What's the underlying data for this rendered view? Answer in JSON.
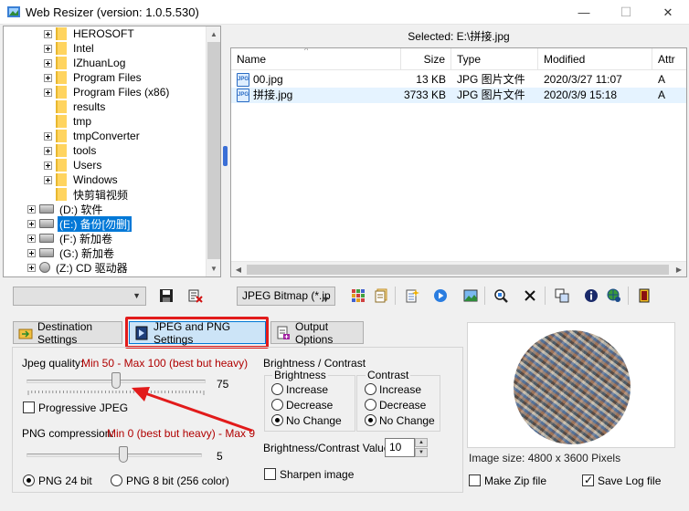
{
  "window": {
    "title": "Web Resizer (version: 1.0.5.530)",
    "minimize_glyph": "—",
    "maximize_glyph": "☐",
    "close_glyph": "✕"
  },
  "tree": {
    "items": [
      {
        "label": "HEROSOFT",
        "type": "folder",
        "expandable": true
      },
      {
        "label": "Intel",
        "type": "folder",
        "expandable": true
      },
      {
        "label": "IZhuanLog",
        "type": "folder",
        "expandable": true
      },
      {
        "label": "Program Files",
        "type": "folder",
        "expandable": true
      },
      {
        "label": "Program Files (x86)",
        "type": "folder",
        "expandable": true
      },
      {
        "label": "results",
        "type": "folder",
        "expandable": false
      },
      {
        "label": "tmp",
        "type": "folder",
        "expandable": false
      },
      {
        "label": "tmpConverter",
        "type": "folder",
        "expandable": true
      },
      {
        "label": "tools",
        "type": "folder",
        "expandable": true
      },
      {
        "label": "Users",
        "type": "folder",
        "expandable": true
      },
      {
        "label": "Windows",
        "type": "folder",
        "expandable": true
      },
      {
        "label": "快剪辑视频",
        "type": "folder",
        "expandable": false
      },
      {
        "label": "(D:) 软件",
        "type": "drive",
        "expandable": true
      },
      {
        "label": "(E:) 备份[勿删]",
        "type": "drive",
        "expandable": true,
        "selected": true
      },
      {
        "label": "(F:) 新加卷",
        "type": "drive",
        "expandable": true
      },
      {
        "label": "(G:) 新加卷",
        "type": "drive",
        "expandable": true
      },
      {
        "label": "(Z:) CD 驱动器",
        "type": "cd",
        "expandable": true
      }
    ]
  },
  "files": {
    "selected_path": "Selected: E:\\拼接.jpg",
    "columns": [
      "Name",
      "Size",
      "Type",
      "Modified",
      "Attr"
    ],
    "rows": [
      {
        "name": "00.jpg",
        "size": "13 KB",
        "type": "JPG 图片文件",
        "modified": "2020/3/27 11:07",
        "attr": "A"
      },
      {
        "name": "拼接.jpg",
        "size": "3733 KB",
        "type": "JPG 图片文件",
        "modified": "2020/3/9 15:18",
        "attr": "A"
      }
    ]
  },
  "toolbar": {
    "left_combo_value": "",
    "format_combo_value": "JPEG Bitmap (*.jp"
  },
  "tabs": {
    "destination": "Destination Settings",
    "jpeg_png": "JPEG and PNG Settings",
    "output": "Output Options"
  },
  "jpeg": {
    "quality_label": "Jpeg quality:",
    "quality_hint": "Min 50 - Max 100 (best but heavy)",
    "quality_value": "75",
    "quality_min": 50,
    "quality_max": 100,
    "progressive_label": "Progressive JPEG",
    "progressive_checked": false
  },
  "png": {
    "compression_label": "PNG compression:",
    "compression_hint": "Min 0 (best but heavy) - Max 9",
    "compression_value": "5",
    "compression_min": 0,
    "compression_max": 9,
    "bit24_label": "PNG 24 bit",
    "bit8_label": "PNG 8 bit (256 color)",
    "selected": "24"
  },
  "brightness_contrast": {
    "group_label": "Brightness / Contrast",
    "brightness_label": "Brightness",
    "contrast_label": "Contrast",
    "increase": "Increase",
    "decrease": "Decrease",
    "no_change": "No Change",
    "brightness_selected": "no_change",
    "contrast_selected": "no_change",
    "value_label": "Brightness/Contrast Value:",
    "value": "10",
    "sharpen_label": "Sharpen image",
    "sharpen_checked": false
  },
  "preview": {
    "size_text": "Image size: 4800 x 3600 Pixels",
    "make_zip_label": "Make Zip file",
    "make_zip_checked": false,
    "save_log_label": "Save Log file",
    "save_log_checked": true
  },
  "colors": {
    "selection": "#0078d7",
    "highlight_outline": "#e21b1b",
    "hint_red": "#b00000"
  }
}
